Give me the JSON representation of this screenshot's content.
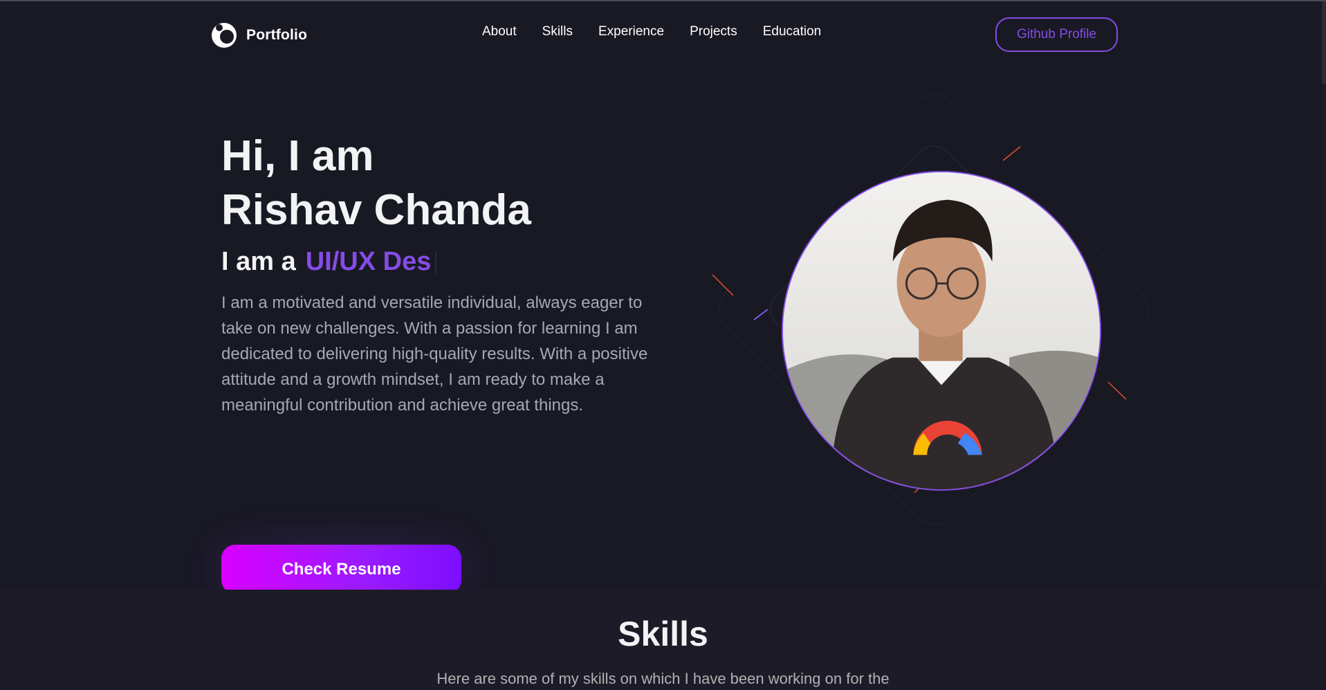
{
  "navbar": {
    "logo_text": "Portfolio",
    "links": [
      "About",
      "Skills",
      "Experience",
      "Projects",
      "Education"
    ],
    "github_label": "Github Profile"
  },
  "hero": {
    "title_line1": "Hi, I am",
    "title_line2": "Rishav Chanda",
    "role_prefix": "I am a",
    "role_typed": "UI/UX Des",
    "description": "I am a motivated and versatile individual, always eager to take on new challenges. With a passion for learning I am dedicated to delivering high-quality results. With a positive attitude and a growth mindset, I am ready to make a meaningful contribution and achieve great things.",
    "resume_label": "Check Resume"
  },
  "skills": {
    "title": "Skills",
    "description": "Here are some of my skills on which I have been working on for the"
  },
  "colors": {
    "background": "#191924",
    "accent": "#854ce6",
    "text_primary": "#f2f3f4",
    "text_secondary": "#b1b2b3",
    "button_gradient_start": "#d900ff",
    "button_gradient_end": "#7d0dff"
  },
  "icons": {
    "logo": "portfolio-logo-icon"
  }
}
